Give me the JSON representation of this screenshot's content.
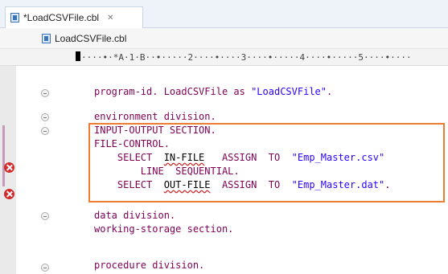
{
  "tab": {
    "title": "*LoadCSVFile.cbl",
    "close_glyph": "✕"
  },
  "breadcrumb": {
    "label": "LoadCSVFile.cbl"
  },
  "ruler": {
    "text": "····•·*A·1·B··•·····2····•····3····•·····4····•·····5····•····"
  },
  "code": {
    "l1_kw": "program-id. LoadCSVFile as ",
    "l1_str": "\"LoadCSVFile\"",
    "l1_end": ".",
    "l2": "environment division.",
    "l3": "INPUT-OUTPUT SECTION.",
    "l4": "FILE-CONTROL.",
    "l5_pre": "    SELECT  ",
    "l5_err": "IN-FILE",
    "l5_mid": "   ASSIGN  TO  ",
    "l5_str": "\"Emp_Master.csv\"",
    "l6": "        LINE  SEQUENTIAL.",
    "l7_pre": "    SELECT  ",
    "l7_err": "OUT-FILE",
    "l7_mid": "  ASSIGN  TO  ",
    "l7_str": "\"Emp_Master.dat\"",
    "l7_end": ".",
    "l8": "data division.",
    "l9": "working-storage section.",
    "l10": "procedure division."
  }
}
